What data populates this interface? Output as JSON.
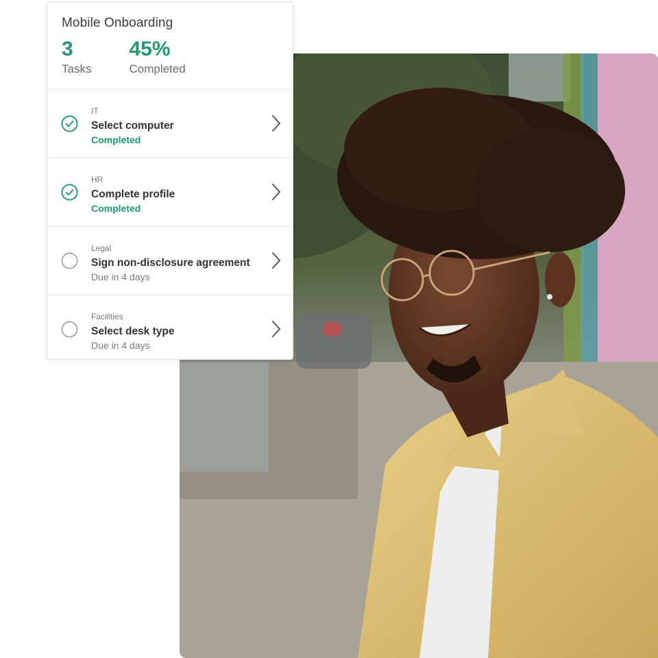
{
  "onboarding": {
    "title": "Mobile Onboarding",
    "tasks_count": "3",
    "tasks_label": "Tasks",
    "completed_value": "45%",
    "completed_label": "Completed",
    "accent_color": "#1f9b6e",
    "tasks": [
      {
        "category": "IT",
        "name": "Select computer",
        "status": "Completed",
        "state": "completed",
        "icon": "check-circle-icon"
      },
      {
        "category": "HR",
        "name": "Complete profile",
        "status": "Completed",
        "state": "completed",
        "icon": "check-circle-icon"
      },
      {
        "category": "Legal",
        "name": "Sign non-disclosure agreement",
        "status": "Due in 4 days",
        "state": "pending",
        "icon": "empty-circle-icon"
      },
      {
        "category": "Facilities",
        "name": "Select desk type",
        "status": "Due in 4 days",
        "state": "pending",
        "icon": "empty-circle-icon"
      }
    ]
  },
  "photo": {
    "subject": "smiling young man with curly hair, round glasses and a yellow corduroy shirt on a city sidewalk"
  }
}
